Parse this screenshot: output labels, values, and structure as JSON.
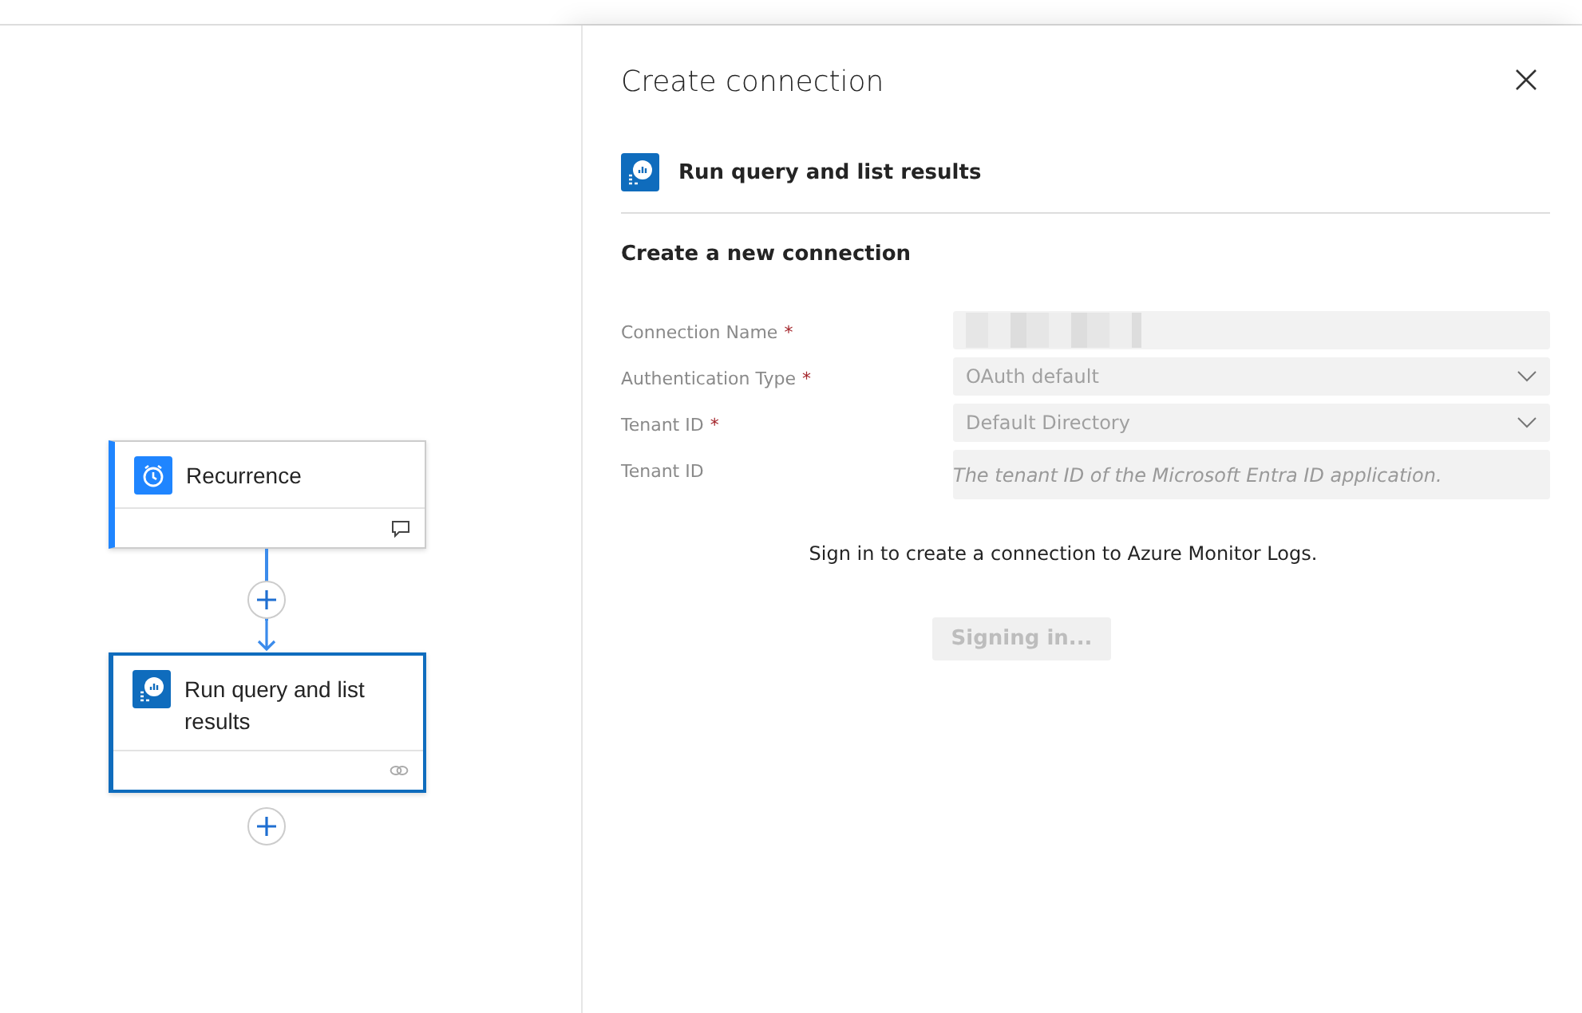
{
  "flow": {
    "steps": [
      {
        "kind": "trigger",
        "title": "Recurrence",
        "selected": false
      },
      {
        "kind": "action",
        "title": "Run query and list results",
        "selected": true
      }
    ]
  },
  "panel": {
    "title": "Create connection",
    "action": "Run query and list results",
    "section": "Create a new connection",
    "fields": [
      {
        "kind": "text",
        "label": "Connection Name",
        "required_mark": "*",
        "redacted": true
      },
      {
        "kind": "dropdown",
        "label": "Authentication Type",
        "required_mark": "*",
        "value": "OAuth default"
      },
      {
        "kind": "dropdown",
        "label": "Tenant ID",
        "required_mark": "*",
        "value": "Default Directory"
      },
      {
        "kind": "text",
        "label": "Tenant ID",
        "placeholder": "The tenant ID of the Microsoft Entra ID application."
      }
    ],
    "message": "Sign in to create a connection to Azure Monitor Logs.",
    "button": {
      "label": "Signing in...",
      "disabled": true
    }
  }
}
